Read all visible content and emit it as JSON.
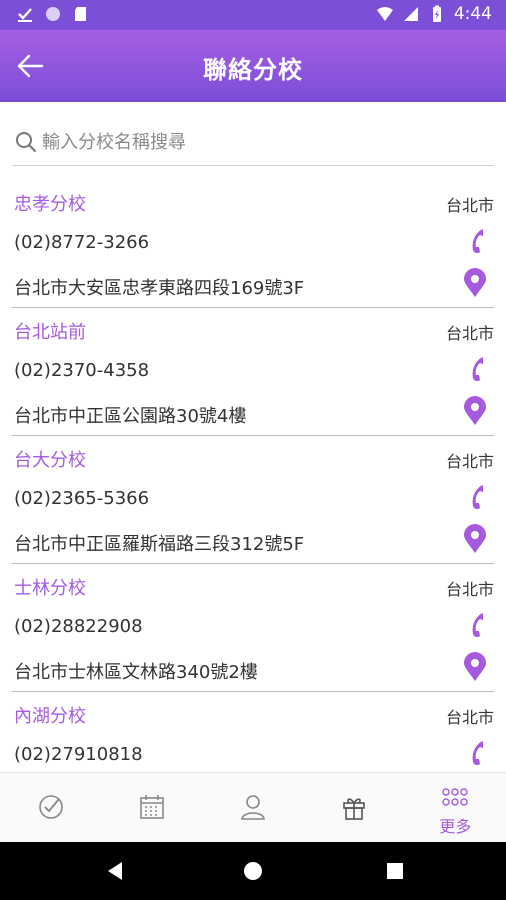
{
  "status_bar": {
    "time": "4:44"
  },
  "header": {
    "title": "聯絡分校"
  },
  "search": {
    "placeholder": "輸入分校名稱搜尋"
  },
  "branches": [
    {
      "name": "忠孝分校",
      "city": "台北市",
      "phone": "(02)8772-3266",
      "address": "台北市大安區忠孝東路四段169號3F"
    },
    {
      "name": "台北站前",
      "city": "台北市",
      "phone": "(02)2370-4358",
      "address": "台北市中正區公園路30號4樓"
    },
    {
      "name": "台大分校",
      "city": "台北市",
      "phone": "(02)2365-5366",
      "address": "台北市中正區羅斯福路三段312號5F"
    },
    {
      "name": "士林分校",
      "city": "台北市",
      "phone": "(02)28822908",
      "address": "台北市士林區文林路340號2樓"
    },
    {
      "name": "內湖分校",
      "city": "台北市",
      "phone": "(02)27910818",
      "address": ""
    }
  ],
  "bottom_nav": {
    "more_label": "更多"
  },
  "colors": {
    "accent": "#a55be0",
    "header_top": "#a65ee3",
    "header_bottom": "#7c4ed8",
    "status_bar": "#7b4fd6"
  }
}
